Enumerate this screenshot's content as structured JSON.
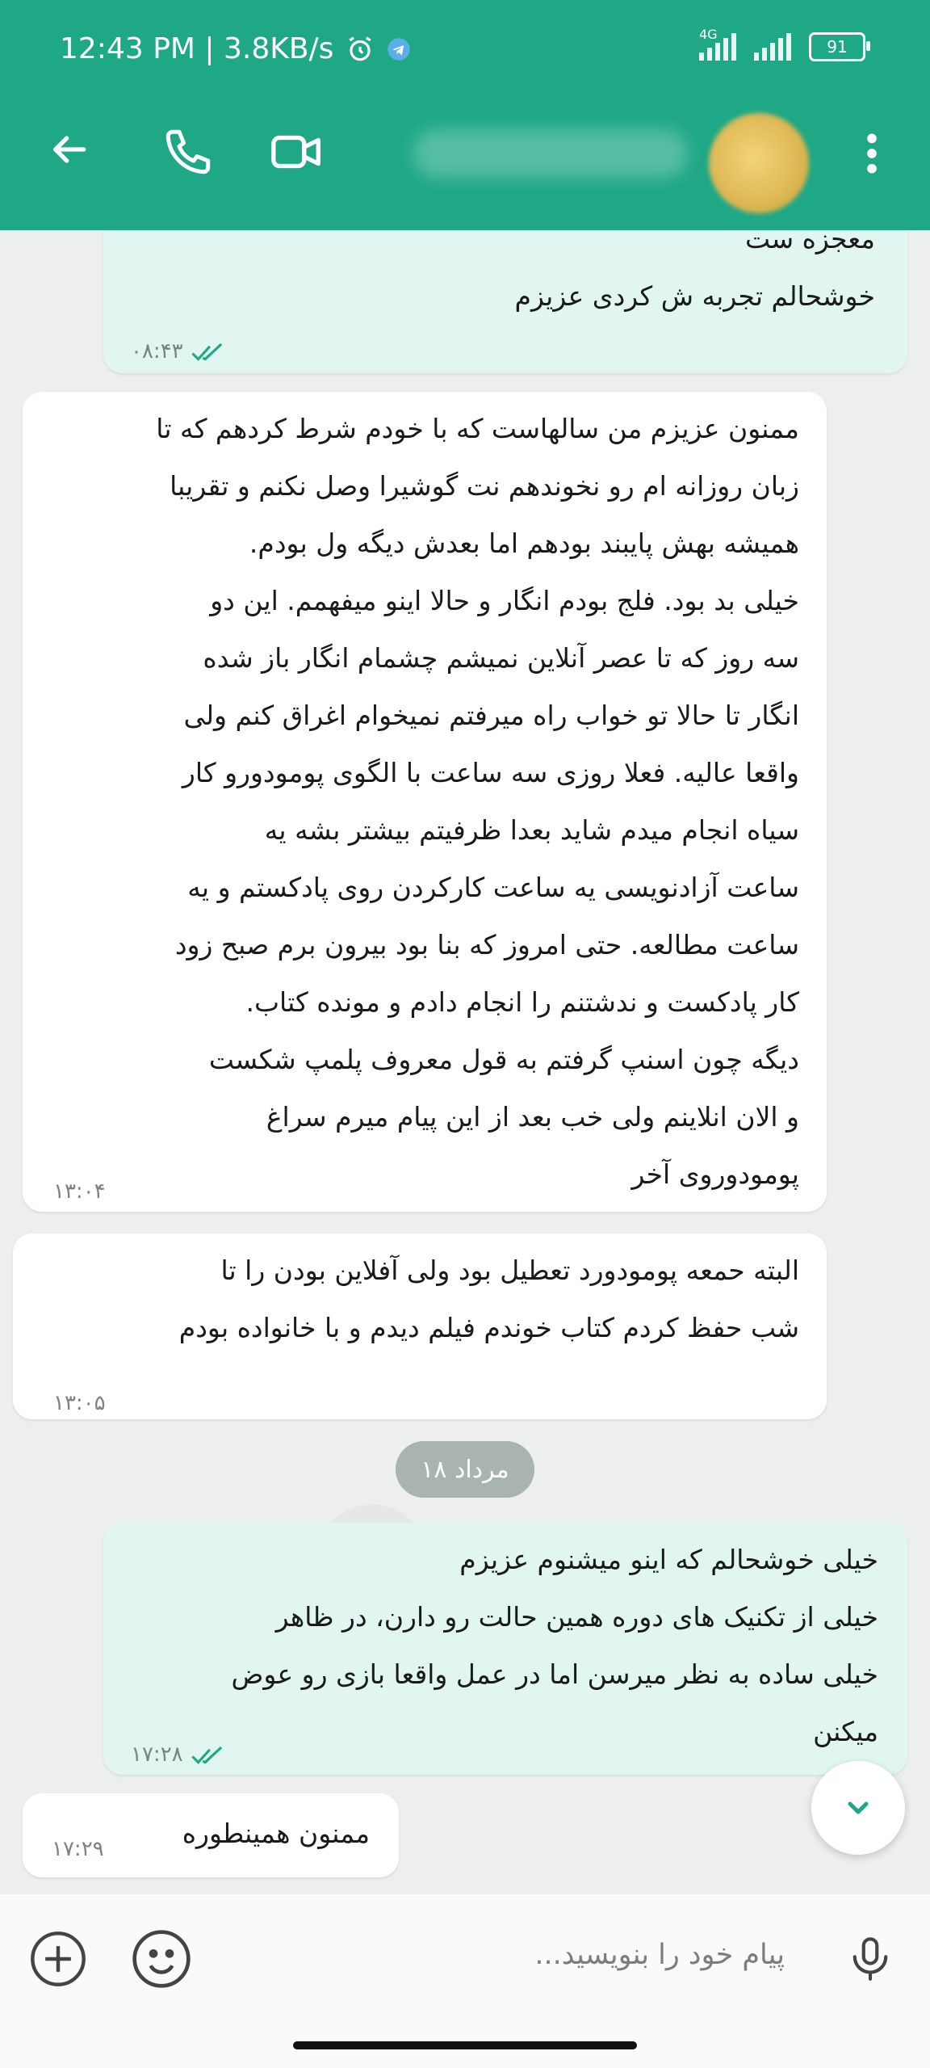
{
  "status_bar": {
    "time": "12:43 PM | 3.8KB/s",
    "network_label": "4G",
    "battery": "91"
  },
  "header": {
    "back_icon": "arrow-left-icon",
    "call_icon": "phone-icon",
    "video_icon": "video-camera-icon",
    "menu_icon": "more-vertical-icon"
  },
  "messages": [
    {
      "direction": "out",
      "lines": [
        "معجزه ست",
        "خوشحالم تجربه ش کردی عزیزم"
      ],
      "time": "۰۸:۴۳",
      "read": true
    },
    {
      "direction": "in",
      "lines": [
        "ممنون عزیزم  من سالهاست که با خودم شرط کردهم که تا",
        "زبان روزانه ام رو نخوندهم نت گوشیرا وصل نکنم و تقریبا",
        "همیشه بهش پایبند بودهم اما بعدش دیگه ول بودم.",
        "خیلی بد بود. فلج بودم انگار و حالا اینو میفهمم.   این دو",
        "سه روز که تا عصر آنلاین نمیشم چشمام انگار باز شده",
        "انگار تا حالا تو خواب راه میرفتم  نمیخوام اغراق کنم ولی",
        "واقعا عالیه.  فعلا روزی سه ساعت با الگوی پومودورو کار",
        "سیاه انجام میدم شاید بعدا ظرفیتم بیشتر بشه   یه",
        "ساعت آزادنویسی یه ساعت کارکردن روی پادکستم و یه",
        "ساعت مطالعه. حتی امروز که بنا بود بیرون برم صبح زود",
        "کار پادکست و ندشتنم را انجام دادم و مونده کتاب.",
        "دیگه چون اسنپ گرفتم به قول معروف پلمپ شکست",
        "و الان انلاینم ولی خب بعد از این پیام میرم سراغ",
        "پومودوروی آخر"
      ],
      "time": "۱۳:۰۴"
    },
    {
      "direction": "in",
      "lines": [
        "البته حمعه پومودورد تعطیل بود ولی آفلاین بودن را تا",
        "شب حفظ کردم کتاب خوندم فیلم دیدم و با خانواده بودم"
      ],
      "time": "۱۳:۰۵"
    },
    {
      "direction": "out",
      "lines": [
        "خیلی خوشحالم که اینو میشنوم عزیزم",
        "خیلی از تکنیک های دوره همین حالت رو دارن، در ظاهر",
        "خیلی ساده به نظر میرسن اما در عمل واقعا بازی رو عوض",
        "میکنن"
      ],
      "time": "۱۷:۲۸",
      "read": true
    },
    {
      "direction": "in",
      "lines": [
        "ممنون همینطوره"
      ],
      "time": "۱۷:۲۹"
    }
  ],
  "date_separator": "۱۸ مرداد",
  "composer": {
    "placeholder": "پیام خود را بنویسید...",
    "add_icon": "plus-circle-icon",
    "emoji_icon": "emoji-icon",
    "mic_icon": "microphone-icon"
  },
  "colors": {
    "header": "#1fa886",
    "outgoing_bubble": "#e1f6f1",
    "incoming_bubble": "#ffffff",
    "read_tick": "#1fa886"
  }
}
